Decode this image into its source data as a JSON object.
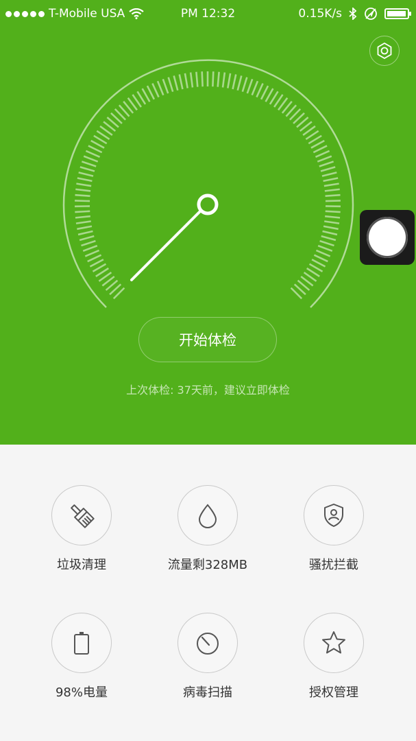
{
  "status_bar": {
    "carrier": "T-Mobile USA",
    "time": "PM 12:32",
    "network_speed": "0.15K/s",
    "battery_level": 0.98,
    "icons": [
      "signal-dots-icon",
      "wifi-icon",
      "bluetooth-icon",
      "location-icon",
      "battery-icon"
    ]
  },
  "header": {
    "settings_icon": "gear-icon"
  },
  "gauge": {
    "needle_icon": "gauge-needle"
  },
  "main": {
    "start_button_label": "开始体检",
    "last_check_text": "上次体检: 37天前，建议立即体检"
  },
  "tools": [
    {
      "label": "垃圾清理",
      "icon": "broom-icon"
    },
    {
      "label": "流量剩328MB",
      "icon": "droplet-icon"
    },
    {
      "label": "骚扰拦截",
      "icon": "shield-user-icon"
    },
    {
      "label": "98%电量",
      "icon": "battery-icon"
    },
    {
      "label": "病毒扫描",
      "icon": "scan-dial-icon"
    },
    {
      "label": "授权管理",
      "icon": "star-icon"
    }
  ],
  "colors": {
    "hero_green": "#52b01b",
    "background": "#f5f5f5",
    "icon_gray": "#555555"
  }
}
